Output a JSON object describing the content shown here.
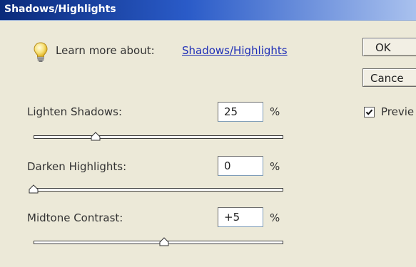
{
  "dialog": {
    "title": "Shadows/Highlights"
  },
  "learn_more": {
    "label": "Learn more about:",
    "link": "Shadows/Highlights"
  },
  "buttons": {
    "ok": "OK",
    "cancel": "Cance"
  },
  "preview": {
    "label": "Previe",
    "checked": true
  },
  "params": [
    {
      "label": "Lighten Shadows:",
      "value": "25",
      "unit": "%",
      "slider_fraction": 0.25
    },
    {
      "label": "Darken Highlights:",
      "value": "0",
      "unit": "%",
      "slider_fraction": 0.0
    },
    {
      "label": "Midtone Contrast:",
      "value": "+5",
      "unit": "%",
      "slider_fraction": 0.525
    }
  ],
  "icons": {
    "learn_more": "lightbulb-icon",
    "preview_check": "checkmark-icon"
  }
}
